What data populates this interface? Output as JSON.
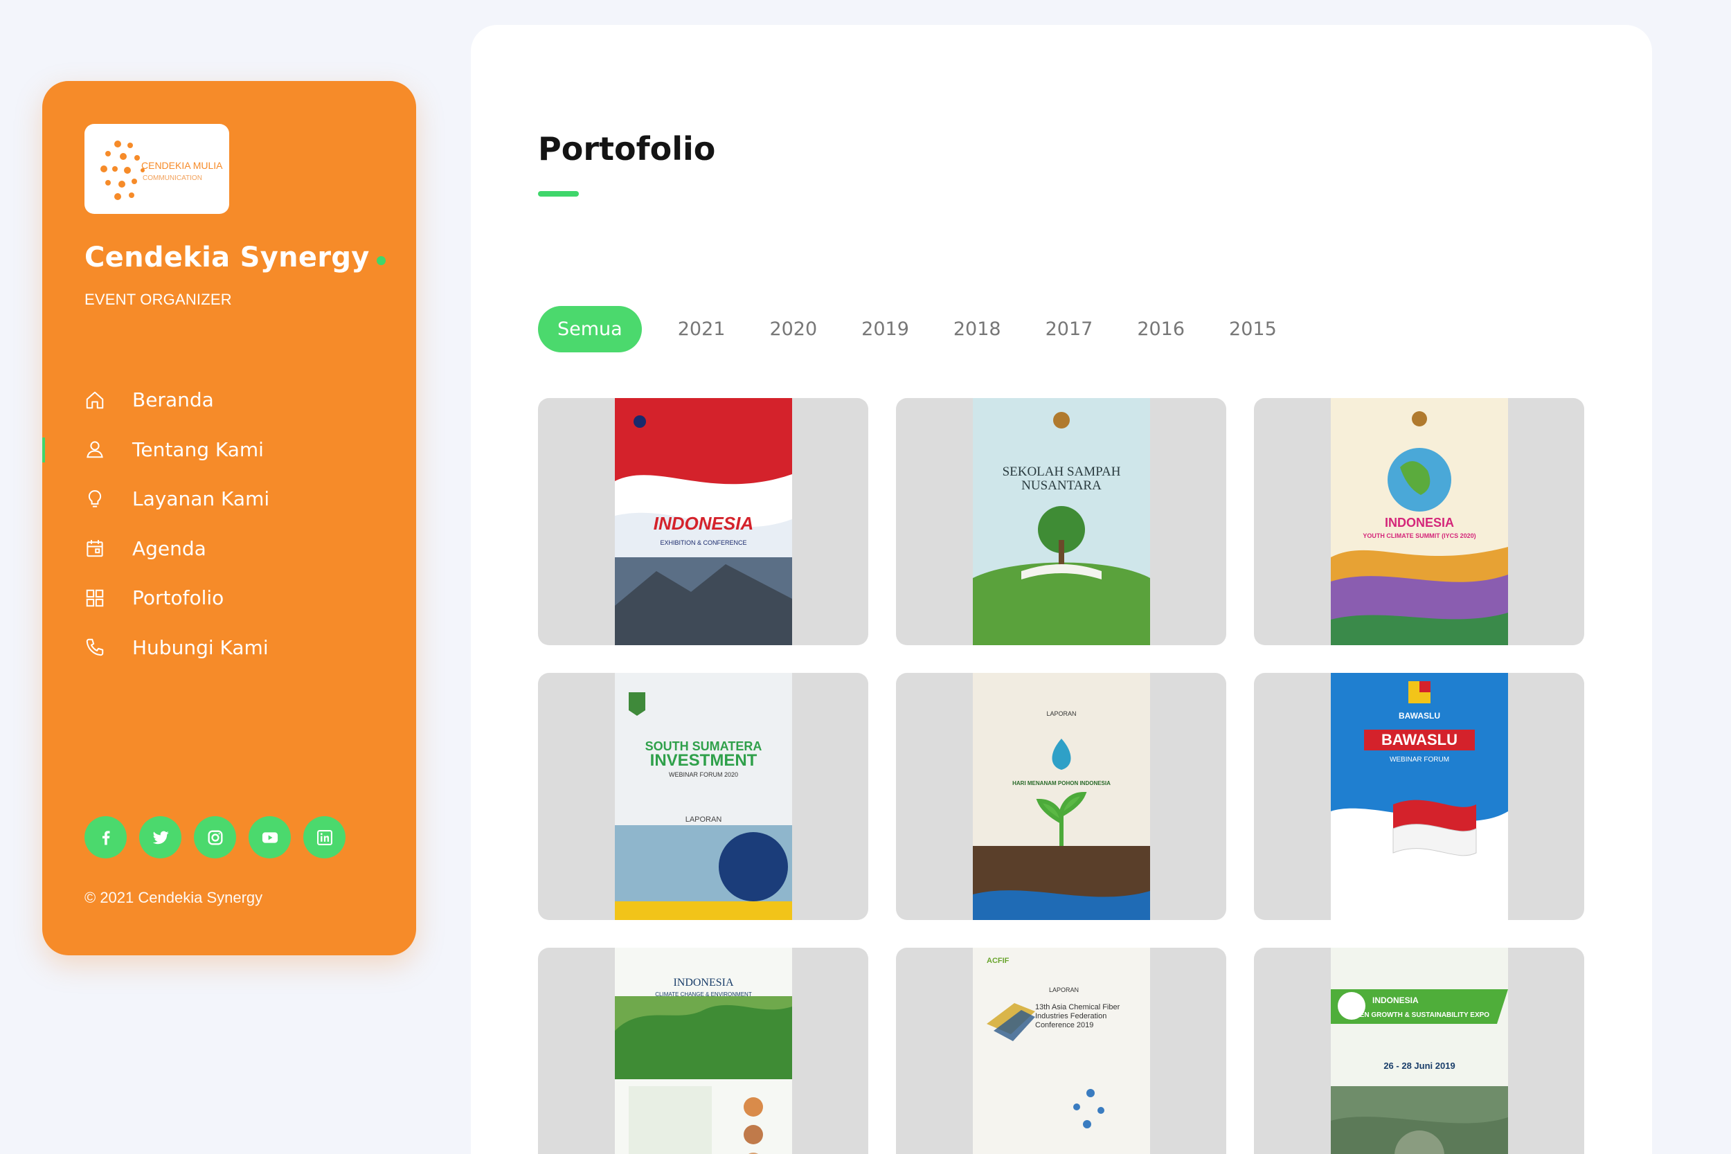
{
  "sidebar": {
    "logo_text_line1": "CENDEKIA MULIA",
    "logo_text_line2": "COMMUNICATION",
    "brand": "Cendekia Synergy",
    "tagline": "EVENT ORGANIZER",
    "nav": [
      {
        "label": "Beranda",
        "icon": "home-icon"
      },
      {
        "label": "Tentang Kami",
        "icon": "user-icon"
      },
      {
        "label": "Layanan Kami",
        "icon": "lightbulb-icon"
      },
      {
        "label": "Agenda",
        "icon": "calendar-icon"
      },
      {
        "label": "Portofolio",
        "icon": "grid-icon"
      },
      {
        "label": "Hubungi Kami",
        "icon": "phone-icon"
      }
    ],
    "socials": [
      "facebook-icon",
      "twitter-icon",
      "instagram-icon",
      "youtube-icon",
      "linkedin-icon"
    ],
    "copyright": "© 2021 Cendekia Synergy"
  },
  "main": {
    "title": "Portofolio",
    "filters": [
      "Semua",
      "2021",
      "2020",
      "2019",
      "2018",
      "2017",
      "2016",
      "2015"
    ],
    "active_filter": "Semua"
  },
  "portfolio": [
    {
      "headline": "INDONESIA",
      "sub": "EXHIBITION & CONFERENCE"
    },
    {
      "headline": "SEKOLAH SAMPAH",
      "sub": "NUSANTARA"
    },
    {
      "headline": "INDONESIA",
      "sub": "YOUTH CLIMATE SUMMIT (IYCS 2020)"
    },
    {
      "headline": "SOUTH SUMATERA",
      "sub": "INVESTMENT",
      "extra": "WEBINAR FORUM 2020",
      "report": "LAPORAN"
    },
    {
      "headline": "LAPORAN",
      "sub": "HARI MENANAM POHON INDONESIA"
    },
    {
      "headline": "BAWASLU",
      "sub": "WEBINAR FORUM"
    },
    {
      "headline": "INDONESIA",
      "sub": "CLIMATE CHANGE & ENVIRONMENT"
    },
    {
      "headline": "LAPORAN",
      "sub": "13th Asia Chemical Fiber Industries Federation Conference 2019",
      "top": "ACFIF"
    },
    {
      "headline": "INDONESIA",
      "sub": "GREEN GROWTH & SUSTAINABILITY EXPO",
      "date": "26 - 28 Juni 2019"
    }
  ],
  "colors": {
    "sidebar_bg": "#f68b29",
    "accent_green": "#4bd96d",
    "page_bg": "#f3f5fb",
    "card_bg": "#dcdcdc"
  }
}
